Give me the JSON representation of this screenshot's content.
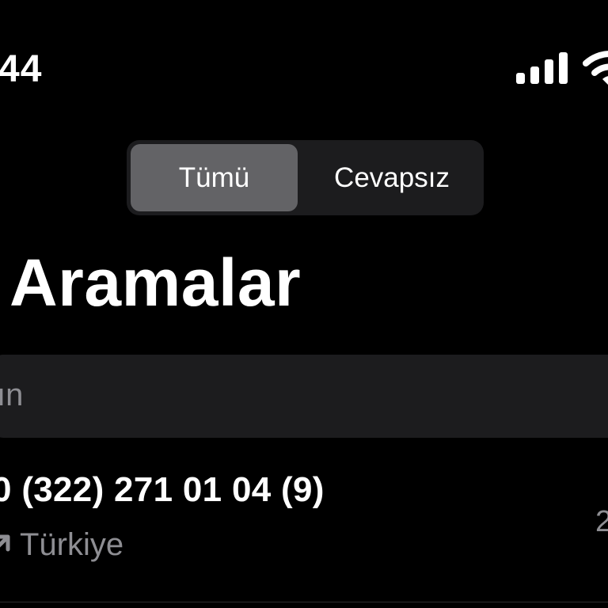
{
  "status_bar": {
    "time": "44",
    "icons": [
      "cellular-signal-icon",
      "wifi-icon"
    ]
  },
  "segmented_control": {
    "segments": [
      {
        "label": "Tümü",
        "selected": true
      },
      {
        "label": "Cevapsız",
        "selected": false
      }
    ]
  },
  "header": {
    "title": "Aramalar"
  },
  "search": {
    "placeholder": "ın"
  },
  "calls": [
    {
      "number": "(322) 271 01 04 (9)",
      "number_prefix": "0",
      "location": "Türkiye",
      "date": "2",
      "icon": "outgoing-call-icon"
    }
  ],
  "colors": {
    "background": "#000000",
    "segmented_bg": "#1c1c1e",
    "segment_selected": "#636366",
    "search_bg": "#1c1c1e",
    "secondary_text": "#8e8e93"
  }
}
